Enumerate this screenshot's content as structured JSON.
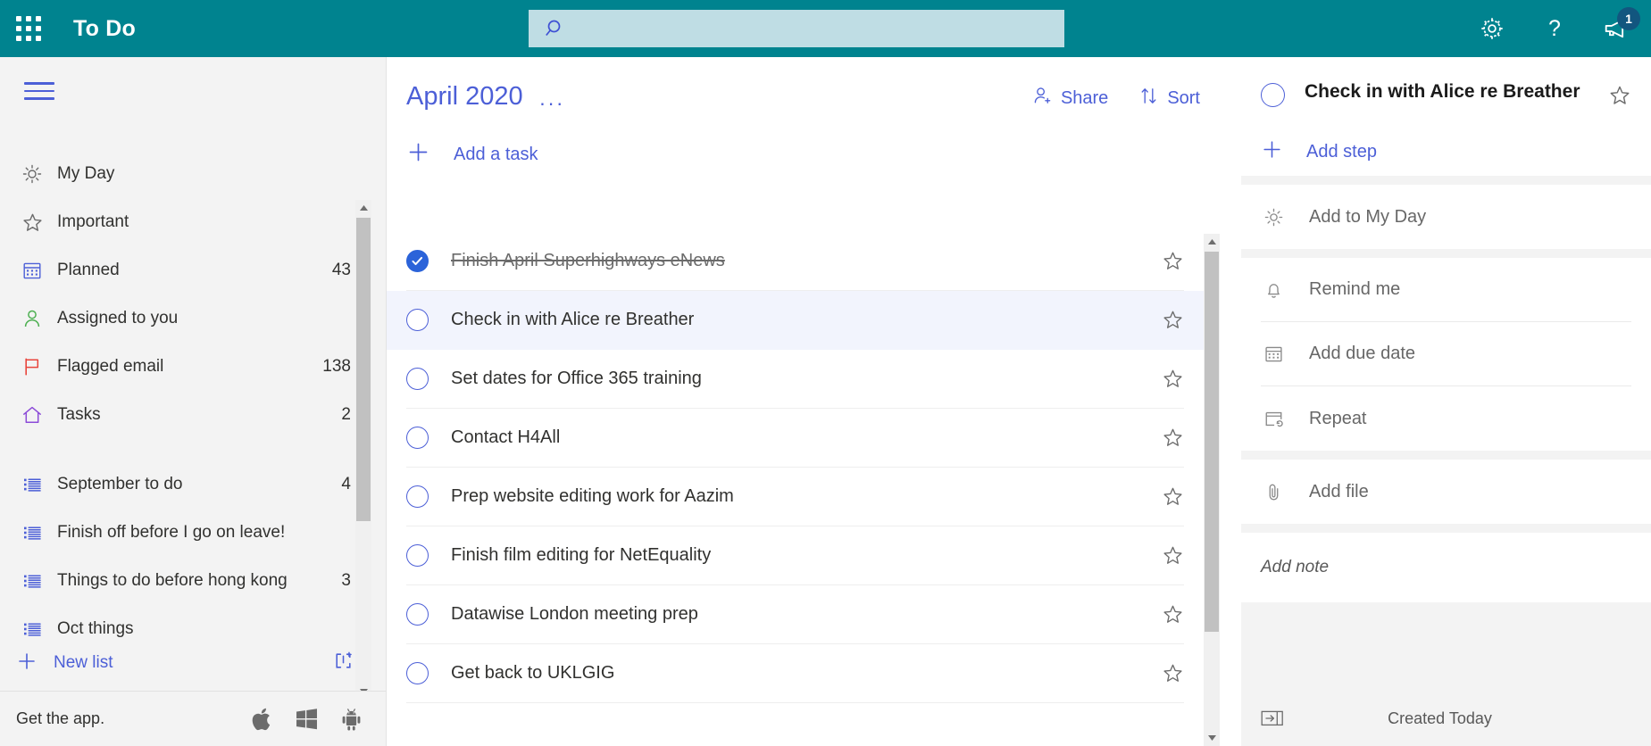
{
  "suitebar": {
    "waffle_label": "app-launcher",
    "app_title": "To Do",
    "search_placeholder": "",
    "search_value": "",
    "settings_label": "Settings",
    "help_label": "Help",
    "feedback_label": "Feedback",
    "feedback_badge": "1",
    "accent_color": "#00838f",
    "search_bg": "#bfdde4"
  },
  "sidebar": {
    "menu_label": "Collapse navigation",
    "smart_lists": [
      {
        "label": "My Day",
        "count": "",
        "icon": "sun-icon",
        "color": "#6b6b6b"
      },
      {
        "label": "Important",
        "count": "",
        "icon": "star-icon",
        "color": "#6b6b6b"
      },
      {
        "label": "Planned",
        "count": "43",
        "icon": "calendar-icon",
        "color": "#4c5fd7"
      },
      {
        "label": "Assigned to you",
        "count": "",
        "icon": "person-icon",
        "color": "#4caf50"
      },
      {
        "label": "Flagged email",
        "count": "138",
        "icon": "flag-icon",
        "color": "#e8453c"
      },
      {
        "label": "Tasks",
        "count": "2",
        "icon": "home-icon",
        "color": "#8c4bd8"
      }
    ],
    "user_lists": [
      {
        "label": "September to do",
        "count": "4",
        "icon": "list-icon"
      },
      {
        "label": "Finish off before I go on leave!",
        "count": "",
        "icon": "list-icon"
      },
      {
        "label": "Things to do before hong kong",
        "count": "3",
        "icon": "list-icon"
      },
      {
        "label": "Oct things",
        "count": "",
        "icon": "list-icon"
      }
    ],
    "new_list_label": "New list",
    "new_group_label": "New group",
    "get_app_label": "Get the app.",
    "platforms": [
      "apple-icon",
      "windows-icon",
      "android-icon"
    ]
  },
  "main": {
    "list_title": "April 2020",
    "more_options_label": "···",
    "share_label": "Share",
    "sort_label": "Sort",
    "add_task_label": "Add a task",
    "tasks": [
      {
        "title": "Finish April Superhighways eNews",
        "completed": true,
        "selected": false,
        "starred": false
      },
      {
        "title": "Check in with Alice re Breather",
        "completed": false,
        "selected": true,
        "starred": false
      },
      {
        "title": "Set dates for Office 365 training",
        "completed": false,
        "selected": false,
        "starred": false
      },
      {
        "title": "Contact H4All",
        "completed": false,
        "selected": false,
        "starred": false
      },
      {
        "title": "Prep website editing work for Aazim",
        "completed": false,
        "selected": false,
        "starred": false
      },
      {
        "title": "Finish film editing for NetEquality",
        "completed": false,
        "selected": false,
        "starred": false
      },
      {
        "title": "Datawise London meeting prep",
        "completed": false,
        "selected": false,
        "starred": false
      },
      {
        "title": "Get back to UKLGIG",
        "completed": false,
        "selected": false,
        "starred": false
      }
    ]
  },
  "detail": {
    "task_title": "Check in with Alice re Breather",
    "completed": false,
    "starred": false,
    "add_step_label": "Add step",
    "add_to_my_day_label": "Add to My Day",
    "remind_me_label": "Remind me",
    "due_date_label": "Add due date",
    "repeat_label": "Repeat",
    "add_file_label": "Add file",
    "note_placeholder": "Add note",
    "created_label": "Created Today",
    "collapse_label": "Hide detail view"
  }
}
